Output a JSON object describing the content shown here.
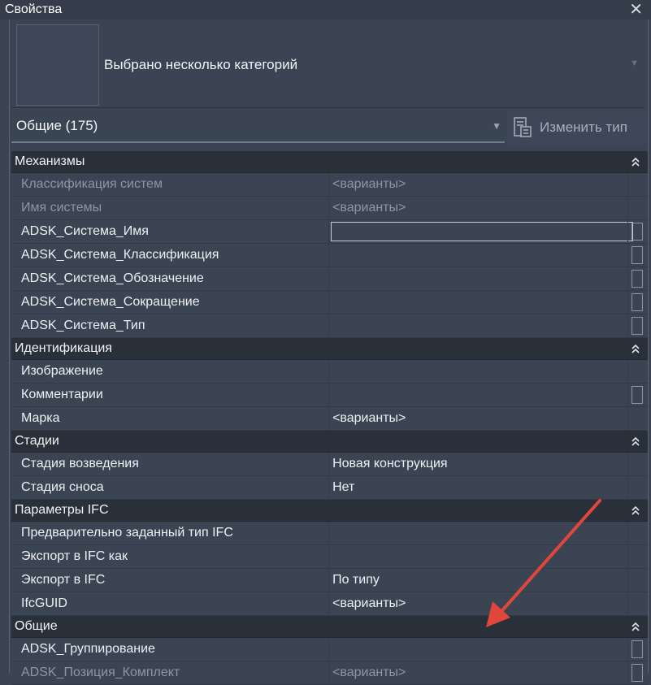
{
  "window": {
    "title": "Свойства",
    "close_icon": "close-icon"
  },
  "type_selector": {
    "name": "Выбрано несколько категорий"
  },
  "filter": {
    "label": "Общие (175)",
    "edit_type_label": "Изменить тип"
  },
  "groups": [
    {
      "title": "Механизмы",
      "rows": [
        {
          "name": "Классификация систем",
          "value": "<варианты>",
          "dim": true,
          "btn": false
        },
        {
          "name": "Имя системы",
          "value": "<варианты>",
          "dim": true,
          "btn": false
        },
        {
          "name": "ADSK_Система_Имя",
          "value": "",
          "dim": false,
          "btn": true,
          "edit": true
        },
        {
          "name": "ADSK_Система_Классификация",
          "value": "",
          "dim": false,
          "btn": true
        },
        {
          "name": "ADSK_Система_Обозначение",
          "value": "",
          "dim": false,
          "btn": true
        },
        {
          "name": "ADSK_Система_Сокращение",
          "value": "",
          "dim": false,
          "btn": true
        },
        {
          "name": "ADSK_Система_Тип",
          "value": "",
          "dim": false,
          "btn": true
        }
      ]
    },
    {
      "title": "Идентификация",
      "rows": [
        {
          "name": "Изображение",
          "value": "",
          "dim": false,
          "btn": false
        },
        {
          "name": "Комментарии",
          "value": "",
          "dim": false,
          "btn": true
        },
        {
          "name": "Марка",
          "value": "<варианты>",
          "dim": false,
          "btn": false
        }
      ]
    },
    {
      "title": "Стадии",
      "rows": [
        {
          "name": "Стадия возведения",
          "value": "Новая конструкция",
          "dim": false,
          "btn": false
        },
        {
          "name": "Стадия сноса",
          "value": "Нет",
          "dim": false,
          "btn": false
        }
      ]
    },
    {
      "title": "Параметры IFC",
      "rows": [
        {
          "name": "Предварительно заданный тип IFC",
          "value": "",
          "dim": false,
          "btn": false
        },
        {
          "name": "Экспорт в IFC как",
          "value": "",
          "dim": false,
          "btn": false
        },
        {
          "name": "Экспорт в IFC",
          "value": "По типу",
          "dim": false,
          "btn": false
        },
        {
          "name": "IfcGUID",
          "value": "<варианты>",
          "dim": false,
          "btn": false
        }
      ]
    },
    {
      "title": "Общие",
      "rows": [
        {
          "name": "ADSK_Группирование",
          "value": "",
          "dim": false,
          "btn": true
        },
        {
          "name": "ADSK_Позиция_Комплект",
          "value": "<варианты>",
          "dim": true,
          "btn": true
        }
      ]
    }
  ],
  "colors": {
    "panel": "#3b4453",
    "group_header": "#2a303a",
    "arrow": "#e0463a"
  }
}
